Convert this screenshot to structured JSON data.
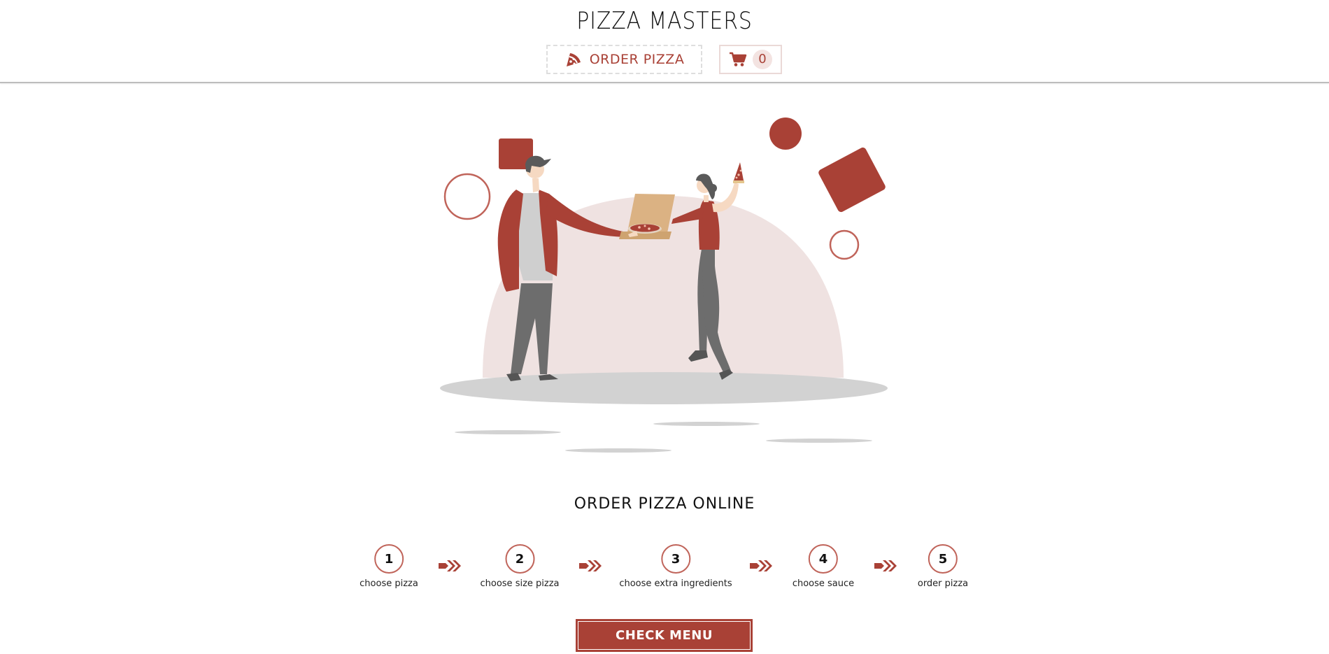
{
  "header": {
    "logo": "PIZZA MASTERS",
    "order_button_label": "ORDER PIZZA",
    "cart_count": "0"
  },
  "icons": {
    "order": "pizza-slice-icon",
    "cart": "shopping-cart-icon",
    "step_arrow": "double-chevron-right-icon"
  },
  "colors": {
    "accent": "#a94136",
    "accent_light": "#c0645a",
    "blob": "#efe2e1",
    "shadow": "#d2d2d2"
  },
  "main": {
    "title": "ORDER PIZZA ONLINE",
    "steps": [
      {
        "number": "1",
        "label": "choose pizza"
      },
      {
        "number": "2",
        "label": "choose size pizza"
      },
      {
        "number": "3",
        "label": "choose extra ingredients"
      },
      {
        "number": "4",
        "label": "choose sauce"
      },
      {
        "number": "5",
        "label": "order pizza"
      }
    ],
    "cta_label": "CHECK MENU"
  }
}
